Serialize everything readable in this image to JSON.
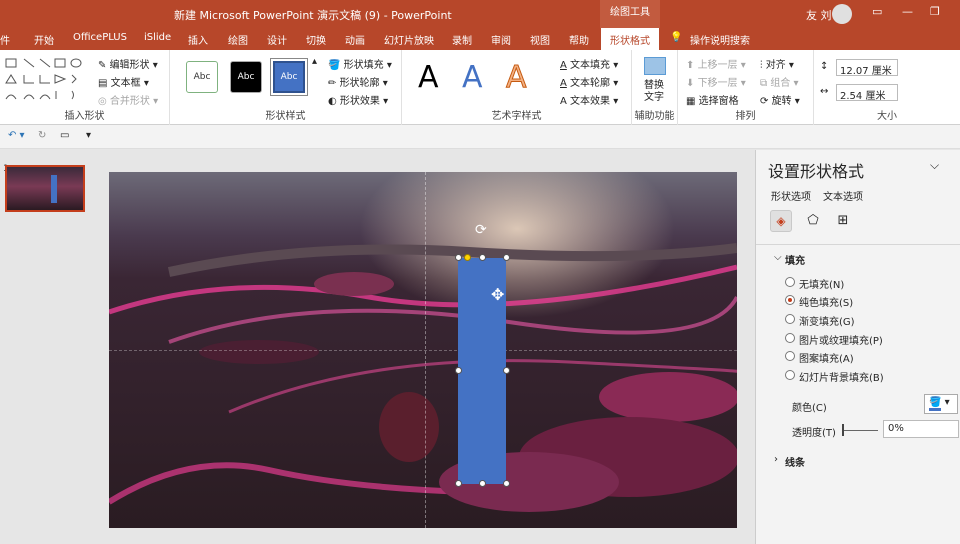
{
  "titlebar": {
    "title": "新建 Microsoft PowerPoint 演示文稿 (9)  -  PowerPoint",
    "context_tool": "绘图工具",
    "user": "友 刘"
  },
  "tabs": [
    "件",
    "开始",
    "OfficePLUS",
    "iSlide",
    "插入",
    "绘图",
    "设计",
    "切换",
    "动画",
    "幻灯片放映",
    "录制",
    "审阅",
    "视图",
    "帮助",
    "形状格式"
  ],
  "tell_me": "操作说明搜索",
  "ribbon": {
    "insert_shapes": {
      "label": "插入形状",
      "edit_shape": "编辑形状",
      "textbox": "文本框",
      "merge_shapes": "合并形状"
    },
    "shape_styles": {
      "label": "形状样式",
      "swatch": "Abc",
      "fill": "形状填充",
      "outline": "形状轮廓",
      "effects": "形状效果"
    },
    "wordart": {
      "label": "艺术字样式",
      "letter": "A",
      "text_fill": "文本填充",
      "text_outline": "文本轮廓",
      "text_effects": "文本效果"
    },
    "accessibility": {
      "label": "辅助功能",
      "alt_text": "替换\n文字"
    },
    "arrange": {
      "label": "排列",
      "bring_forward": "上移一层",
      "send_backward": "下移一层",
      "selection_pane": "选择窗格",
      "align": "对齐",
      "group": "组合",
      "rotate": "旋转"
    },
    "size": {
      "label": "大小",
      "height": "12.07 厘米",
      "width": "2.54 厘米"
    }
  },
  "panel": {
    "title": "设置形状格式",
    "tab_shape": "形状选项",
    "tab_text": "文本选项",
    "fill_section": "填充",
    "options": [
      "无填充(N)",
      "纯色填充(S)",
      "渐变填充(G)",
      "图片或纹理填充(P)",
      "图案填充(A)",
      "幻灯片背景填充(B)"
    ],
    "selected_option": "纯色填充(S)",
    "color_label": "颜色(C)",
    "transparency_label": "透明度(T)",
    "transparency_value": "0%",
    "line_section": "线条"
  },
  "colors": {
    "brand": "#b7472a",
    "shape_fill": "#4472c4",
    "accent": "#c43e1c"
  }
}
